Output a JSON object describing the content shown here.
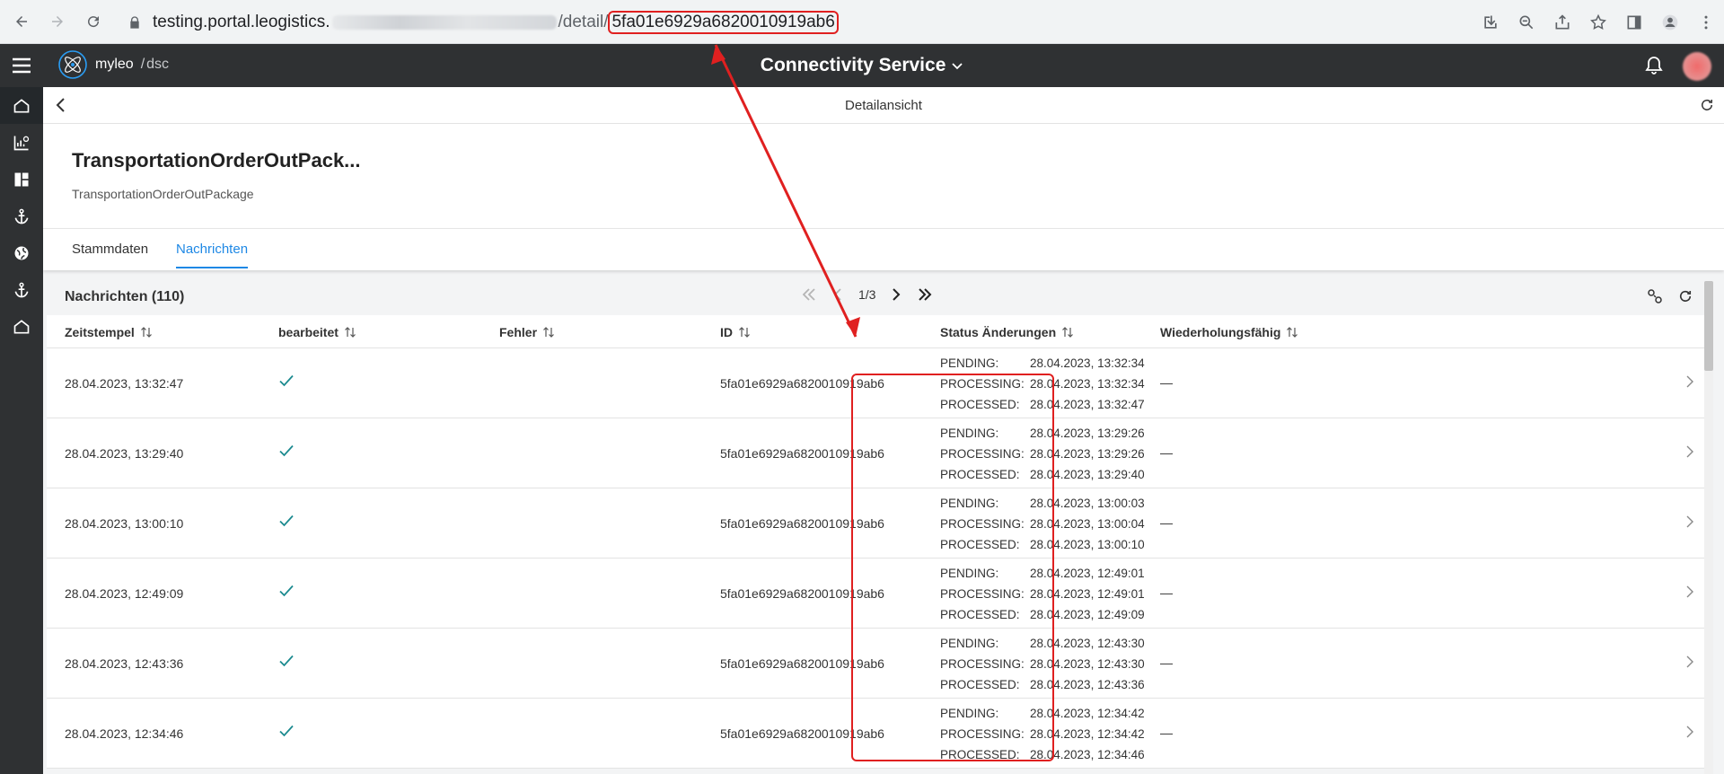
{
  "browser": {
    "url_domain": "testing.portal.leogistics.",
    "url_path": "/detail/",
    "url_id": "5fa01e6929a6820010919ab6"
  },
  "app": {
    "logo_name": "myleo",
    "logo_sep": "/",
    "logo_sub": "dsc",
    "service_title": "Connectivity Service"
  },
  "rail": [
    "home-icon",
    "chart-settings-icon",
    "dashboard-icon",
    "anchor-icon",
    "globe-icon",
    "anchor-icon",
    "home-icon"
  ],
  "detail": {
    "title": "Detailansicht",
    "headline": "TransportationOrderOutPack...",
    "subtitle": "TransportationOrderOutPackage"
  },
  "tabs": [
    {
      "label": "Stammdaten",
      "active": false
    },
    {
      "label": "Nachrichten",
      "active": true
    }
  ],
  "messages": {
    "heading": "Nachrichten (110)",
    "page": "1/3",
    "columns": [
      "Zeitstempel",
      "bearbeitet",
      "Fehler",
      "ID",
      "Status Änderungen",
      "Wiederholungsfähig"
    ],
    "rows": [
      {
        "timestamp": "28.04.2023, 13:32:47",
        "id": "5fa01e6929a6820010919ab6",
        "repeatable": "—",
        "status": [
          {
            "label": "PENDING:",
            "time": "28.04.2023, 13:32:34"
          },
          {
            "label": "PROCESSING:",
            "time": "28.04.2023, 13:32:34"
          },
          {
            "label": "PROCESSED:",
            "time": "28.04.2023, 13:32:47"
          }
        ]
      },
      {
        "timestamp": "28.04.2023, 13:29:40",
        "id": "5fa01e6929a6820010919ab6",
        "repeatable": "—",
        "status": [
          {
            "label": "PENDING:",
            "time": "28.04.2023, 13:29:26"
          },
          {
            "label": "PROCESSING:",
            "time": "28.04.2023, 13:29:26"
          },
          {
            "label": "PROCESSED:",
            "time": "28.04.2023, 13:29:40"
          }
        ]
      },
      {
        "timestamp": "28.04.2023, 13:00:10",
        "id": "5fa01e6929a6820010919ab6",
        "repeatable": "—",
        "status": [
          {
            "label": "PENDING:",
            "time": "28.04.2023, 13:00:03"
          },
          {
            "label": "PROCESSING:",
            "time": "28.04.2023, 13:00:04"
          },
          {
            "label": "PROCESSED:",
            "time": "28.04.2023, 13:00:10"
          }
        ]
      },
      {
        "timestamp": "28.04.2023, 12:49:09",
        "id": "5fa01e6929a6820010919ab6",
        "repeatable": "—",
        "status": [
          {
            "label": "PENDING:",
            "time": "28.04.2023, 12:49:01"
          },
          {
            "label": "PROCESSING:",
            "time": "28.04.2023, 12:49:01"
          },
          {
            "label": "PROCESSED:",
            "time": "28.04.2023, 12:49:09"
          }
        ]
      },
      {
        "timestamp": "28.04.2023, 12:43:36",
        "id": "5fa01e6929a6820010919ab6",
        "repeatable": "—",
        "status": [
          {
            "label": "PENDING:",
            "time": "28.04.2023, 12:43:30"
          },
          {
            "label": "PROCESSING:",
            "time": "28.04.2023, 12:43:30"
          },
          {
            "label": "PROCESSED:",
            "time": "28.04.2023, 12:43:36"
          }
        ]
      },
      {
        "timestamp": "28.04.2023, 12:34:46",
        "id": "5fa01e6929a6820010919ab6",
        "repeatable": "—",
        "status": [
          {
            "label": "PENDING:",
            "time": "28.04.2023, 12:34:42"
          },
          {
            "label": "PROCESSING:",
            "time": "28.04.2023, 12:34:42"
          },
          {
            "label": "PROCESSED:",
            "time": "28.04.2023, 12:34:46"
          }
        ]
      }
    ]
  },
  "colors": {
    "header_bg": "#2f3133",
    "accent": "#1e88e5",
    "check": "#1b8a8f",
    "annotation": "#e02020"
  }
}
